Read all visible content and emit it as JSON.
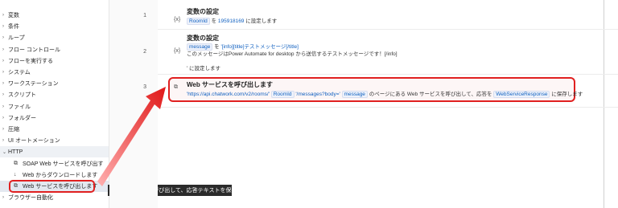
{
  "sidebar": {
    "items": [
      {
        "label": "変数"
      },
      {
        "label": "条件"
      },
      {
        "label": "ループ"
      },
      {
        "label": "フロー コントロール"
      },
      {
        "label": "フローを実行する"
      },
      {
        "label": "システム"
      },
      {
        "label": "ワークステーション"
      },
      {
        "label": "スクリプト"
      },
      {
        "label": "ファイル"
      },
      {
        "label": "フォルダー"
      },
      {
        "label": "圧縮"
      },
      {
        "label": "UI オートメーション"
      }
    ],
    "http": {
      "label": "HTTP",
      "children": [
        {
          "label": "SOAP Web サービスを呼び出す"
        },
        {
          "label": "Web からダウンロードします"
        },
        {
          "label": "Web サービスを呼び出します"
        }
      ]
    },
    "after": {
      "label": "ブラウザー自動化"
    }
  },
  "tooltip": {
    "text": "Web サービスを呼び出して、応答テキストを保存します"
  },
  "steps": [
    {
      "number": "1",
      "icon": "{x}",
      "title": "変数の設定",
      "var": "RoomId",
      "text_a": "を",
      "value": "195918169",
      "text_b": "に設定します"
    },
    {
      "number": "2",
      "icon": "{x}",
      "title": "変数の設定",
      "var": "message",
      "text_a": "を",
      "value1": "'[info][title]テストメッセージ[/title]",
      "value2": "このメッセージはPower Automate for desktop から送信するテストメッセージです！[/info]",
      "text_b": "' に設定します"
    },
    {
      "number": "3",
      "title": "Web サービスを呼び出します",
      "url_a": "'https://api.chatwork.com/v2/rooms/'",
      "var1": "RoomId",
      "url_b": "'/messages?body='",
      "var2": "message",
      "text_a": "のページにある Web サービスを呼び出して、応答を",
      "var3": "WebServiceResponse",
      "text_b": "に保存します"
    }
  ],
  "colors": {
    "highlight": "#e02020",
    "token": "#1060c0"
  }
}
